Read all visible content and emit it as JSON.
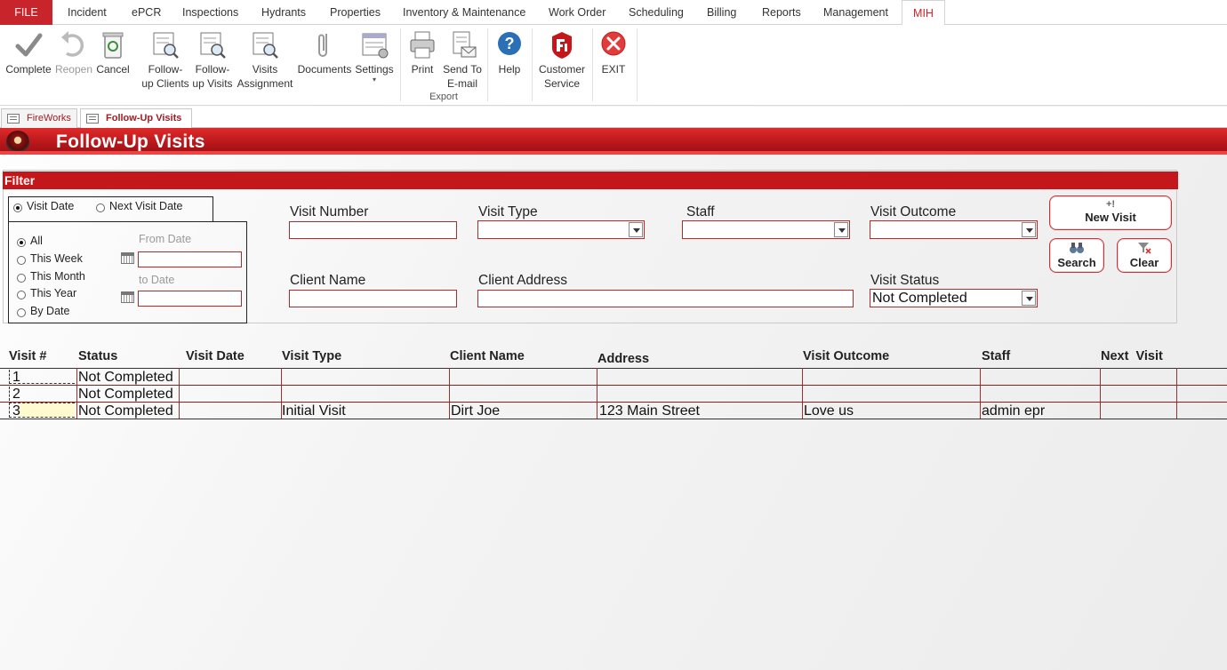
{
  "menu": {
    "file": "FILE",
    "items": [
      "Incident",
      "ePCR",
      "Inspections",
      "Hydrants",
      "Properties",
      "Inventory & Maintenance",
      "Work Order",
      "Scheduling",
      "Billing",
      "Reports",
      "Management"
    ],
    "active": "MIH"
  },
  "ribbon": {
    "complete": "Complete",
    "reopen": "Reopen",
    "cancel": "Cancel",
    "followup_clients_1": "Follow-",
    "followup_clients_2": "up Clients",
    "followup_visits_1": "Follow-",
    "followup_visits_2": "up Visits",
    "visits_assignment_1": "Visits",
    "visits_assignment_2": "Assignment",
    "documents": "Documents",
    "settings": "Settings",
    "print": "Print",
    "send_email_1": "Send To",
    "send_email_2": "E-mail",
    "export_group": "Export",
    "help": "Help",
    "customer_service_1": "Customer",
    "customer_service_2": "Service",
    "exit": "EXIT"
  },
  "tabs": [
    {
      "label": "FireWorks"
    },
    {
      "label": "Follow-Up Visits"
    }
  ],
  "page": {
    "title": "Follow-Up Visits"
  },
  "filter": {
    "header": "Filter",
    "date_mode": {
      "visit_date": "Visit Date",
      "next_visit_date": "Next Visit Date",
      "selected": "Visit Date"
    },
    "period": {
      "all": "All",
      "this_week": "This Week",
      "this_month": "This Month",
      "this_year": "This Year",
      "by_date": "By Date",
      "selected": "All"
    },
    "from_date_label": "From Date",
    "to_date_label": "to Date",
    "from_date": "",
    "to_date": "",
    "visit_number_label": "Visit Number",
    "visit_number": "",
    "visit_type_label": "Visit Type",
    "visit_type": "",
    "staff_label": "Staff",
    "staff": "",
    "visit_outcome_label": "Visit Outcome",
    "visit_outcome": "",
    "client_name_label": "Client Name",
    "client_name": "",
    "client_address_label": "Client Address",
    "client_address": "",
    "visit_status_label": "Visit Status",
    "visit_status": "Not Completed",
    "new_visit": "New Visit",
    "search": "Search",
    "clear": "Clear"
  },
  "grid": {
    "columns": {
      "visit_no": "Visit #",
      "status": "Status",
      "visit_date": "Visit Date",
      "visit_type": "Visit Type",
      "client_name": "Client Name",
      "address": "Address",
      "visit_outcome": "Visit Outcome",
      "staff": "Staff",
      "next_visit": "Next  Visit"
    },
    "rows": [
      {
        "visit_no": "1",
        "status": "Not Completed",
        "visit_date": "",
        "visit_type": "",
        "client_name": "",
        "address": "",
        "visit_outcome": "",
        "staff": "",
        "next_visit": ""
      },
      {
        "visit_no": "2",
        "status": "Not Completed",
        "visit_date": "",
        "visit_type": "",
        "client_name": "",
        "address": "",
        "visit_outcome": "",
        "staff": "",
        "next_visit": ""
      },
      {
        "visit_no": "3",
        "status": "Not Completed",
        "visit_date": "",
        "visit_type": "Initial Visit",
        "client_name": "Dirt Joe",
        "address": "123 Main Street",
        "visit_outcome": "Love us",
        "staff": "admin epr",
        "next_visit": ""
      }
    ]
  },
  "colors": {
    "brand_red": "#c4171c",
    "title_red": "#b5161a",
    "accent_link": "#a11d22"
  }
}
